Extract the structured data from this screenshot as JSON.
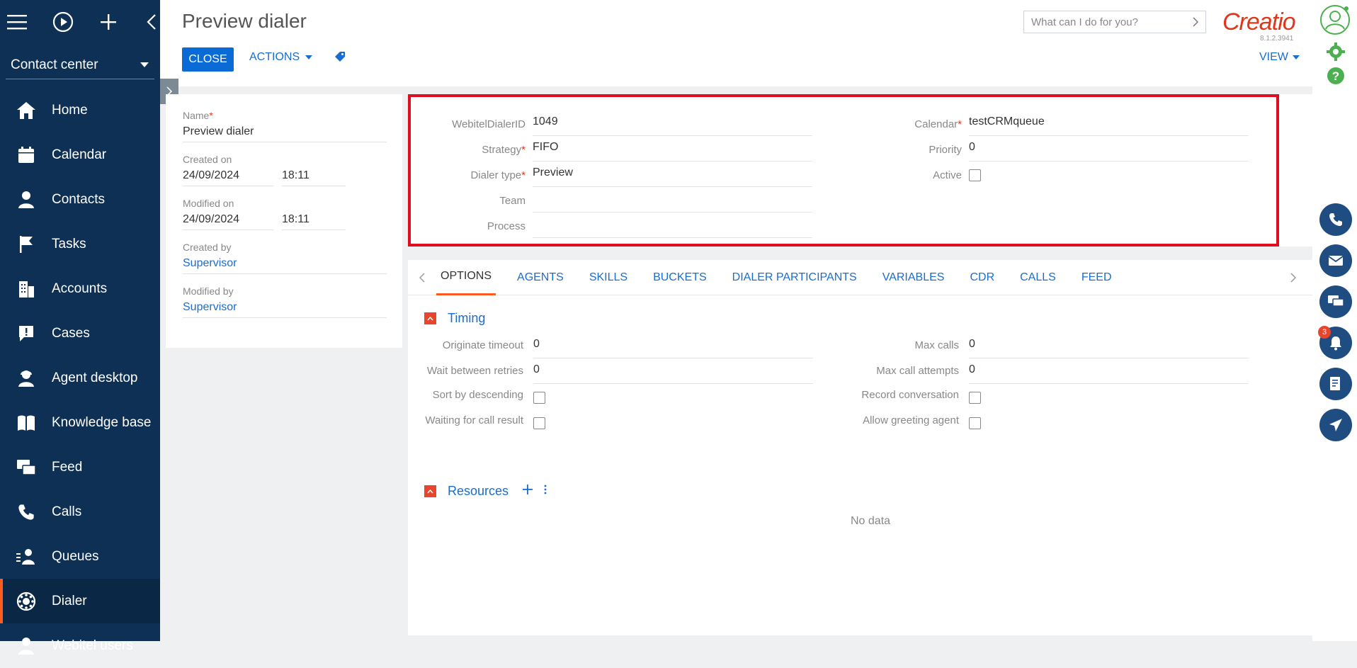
{
  "nav": {
    "workplace": "Contact center",
    "items": [
      {
        "label": "Home",
        "icon": "home-icon"
      },
      {
        "label": "Calendar",
        "icon": "calendar-icon"
      },
      {
        "label": "Contacts",
        "icon": "contact-icon"
      },
      {
        "label": "Tasks",
        "icon": "flag-icon"
      },
      {
        "label": "Accounts",
        "icon": "building-icon"
      },
      {
        "label": "Cases",
        "icon": "case-icon"
      },
      {
        "label": "Agent desktop",
        "icon": "agent-icon"
      },
      {
        "label": "Knowledge base",
        "icon": "book-icon"
      },
      {
        "label": "Feed",
        "icon": "feed-icon"
      },
      {
        "label": "Calls",
        "icon": "phone-icon"
      },
      {
        "label": "Queues",
        "icon": "queue-icon"
      },
      {
        "label": "Dialer",
        "icon": "dialer-icon"
      },
      {
        "label": "Webitel users",
        "icon": "user-icon"
      }
    ],
    "active_index": 11
  },
  "header": {
    "title": "Preview dialer",
    "close_label": "CLOSE",
    "actions_label": "ACTIONS",
    "search_placeholder": "What can I do for you?",
    "logo": "Creatio",
    "version": "8.1.2.3941",
    "view_label": "VIEW"
  },
  "left_card": {
    "name_label": "Name",
    "name_value": "Preview dialer",
    "created_on_label": "Created on",
    "created_on_date": "24/09/2024",
    "created_on_time": "18:11",
    "modified_on_label": "Modified on",
    "modified_on_date": "24/09/2024",
    "modified_on_time": "18:11",
    "created_by_label": "Created by",
    "created_by_value": "Supervisor",
    "modified_by_label": "Modified by",
    "modified_by_value": "Supervisor"
  },
  "main": {
    "webitel_id_label": "WebitelDialerID",
    "webitel_id_value": "1049",
    "strategy_label": "Strategy",
    "strategy_value": "FIFO",
    "dialer_type_label": "Dialer type",
    "dialer_type_value": "Preview",
    "team_label": "Team",
    "team_value": "",
    "process_label": "Process",
    "process_value": "",
    "calendar_label": "Calendar",
    "calendar_value": "testCRMqueue",
    "priority_label": "Priority",
    "priority_value": "0",
    "active_label": "Active",
    "active_checked": false
  },
  "tabs": {
    "items": [
      "OPTIONS",
      "AGENTS",
      "SKILLS",
      "BUCKETS",
      "DIALER PARTICIPANTS",
      "VARIABLES",
      "CDR",
      "CALLS",
      "FEED"
    ],
    "active": "OPTIONS"
  },
  "timing": {
    "title": "Timing",
    "originate_timeout_label": "Originate timeout",
    "originate_timeout_value": "0",
    "wait_retries_label": "Wait between retries",
    "wait_retries_value": "0",
    "sort_desc_label": "Sort by descending",
    "waiting_result_label": "Waiting for call result",
    "max_calls_label": "Max calls",
    "max_calls_value": "0",
    "max_attempts_label": "Max call attempts",
    "max_attempts_value": "0",
    "record_label": "Record conversation",
    "greeting_label": "Allow greeting agent"
  },
  "resources": {
    "title": "Resources",
    "empty_text": "No data"
  },
  "rail": {
    "notification_count": "3"
  },
  "colors": {
    "nav_bg": "#0e3054",
    "accent_orange": "#ff5a1f",
    "primary_blue": "#0a6bd6",
    "link_blue": "#1a6dcf",
    "highlight_red": "#e00f1f",
    "brand_red": "#e0371b"
  }
}
